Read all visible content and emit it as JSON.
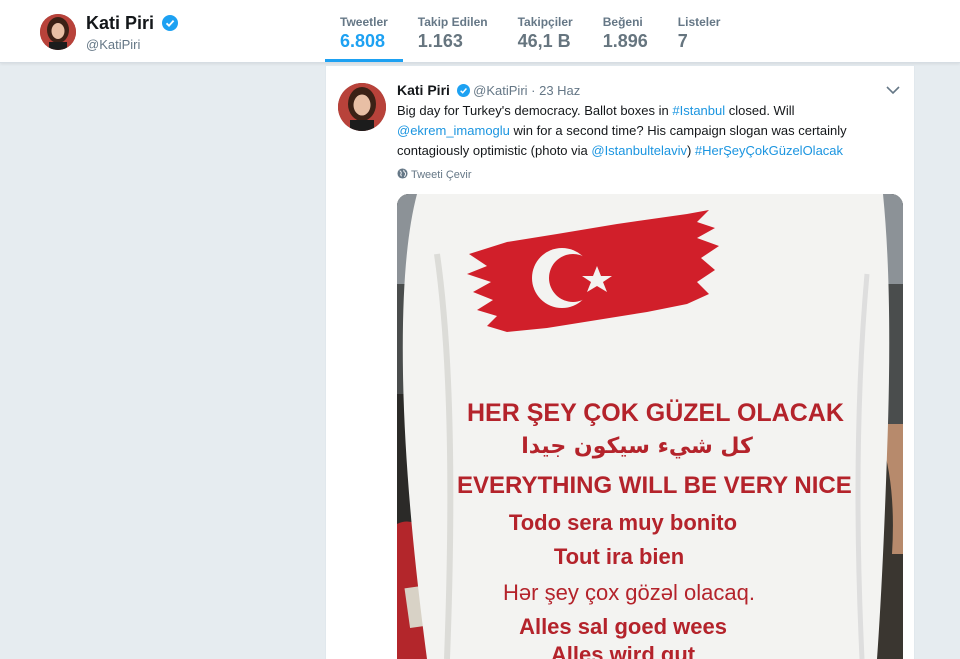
{
  "profile": {
    "name": "Kati Piri",
    "handle": "@KatiPiri"
  },
  "stats": [
    {
      "label": "Tweetler",
      "value": "6.808",
      "active": true
    },
    {
      "label": "Takip Edilen",
      "value": "1.163"
    },
    {
      "label": "Takipçiler",
      "value": "46,1 B"
    },
    {
      "label": "Beğeni",
      "value": "1.896"
    },
    {
      "label": "Listeler",
      "value": "7"
    }
  ],
  "tweet": {
    "name": "Kati Piri",
    "handle": "@KatiPiri",
    "separator": " · ",
    "time": "23 Haz",
    "text": {
      "p1": "Big day for Turkey's democracy. Ballot boxes in ",
      "link1": "#Istanbul",
      "p2": " closed. Will ",
      "link2": "@ekrem_imamoglu",
      "p3": " win for a second time? His campaign slogan was certainly contagiously optimistic (photo via ",
      "link3": "@Istanbultelaviv",
      "p4": ") ",
      "link4": "#HerŞeyÇokGüzelOlacak"
    },
    "translate_label": "Tweeti Çevir",
    "photo": {
      "shirt_lines": [
        "HER ŞEY ÇOK GÜZEL OLACAK",
        "كل شيء سيكون جيدا",
        "EVERYTHING WILL BE VERY NICE",
        "Todo sera muy bonito",
        "Tout ira bien",
        "Hər şey çox gözəl olacaq.",
        "Alles sal goed wees",
        "Alles wird gut"
      ]
    }
  },
  "colors": {
    "accent": "#1da1f2",
    "link": "#1b95e0",
    "background": "#e6ecf0",
    "flag_red": "#d11f2a"
  }
}
